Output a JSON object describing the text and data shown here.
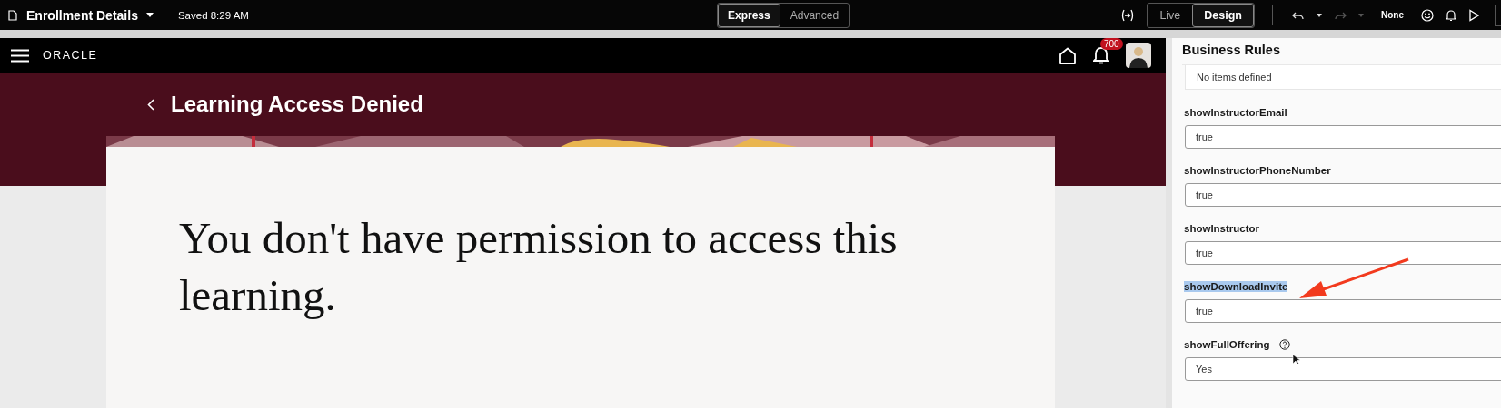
{
  "toolbar": {
    "title": "Enrollment Details",
    "saved": "Saved 8:29 AM",
    "modes": [
      {
        "label": "Express",
        "selected": true
      },
      {
        "label": "Advanced",
        "selected": false
      }
    ],
    "views": [
      {
        "label": "Live",
        "selected": false
      },
      {
        "label": "Design",
        "selected": true
      }
    ],
    "redo_disabled": true,
    "translation": "None"
  },
  "app_header": {
    "logo": "ORACLE",
    "notifications": "700"
  },
  "page": {
    "title": "Learning Access Denied",
    "message": "You don't have permission to access this learning."
  },
  "panel": {
    "title": "Business Rules",
    "empty_text": "No items defined",
    "fields": [
      {
        "label": "showInstructorEmail",
        "value": "true",
        "highlighted": false,
        "help": false
      },
      {
        "label": "showInstructorPhoneNumber",
        "value": "true",
        "highlighted": false,
        "help": false
      },
      {
        "label": "showInstructor",
        "value": "true",
        "highlighted": false,
        "help": false
      },
      {
        "label": "showDownloadInvite",
        "value": "true",
        "highlighted": true,
        "help": false
      },
      {
        "label": "showFullOffering",
        "value": "Yes",
        "highlighted": false,
        "help": true
      }
    ]
  }
}
